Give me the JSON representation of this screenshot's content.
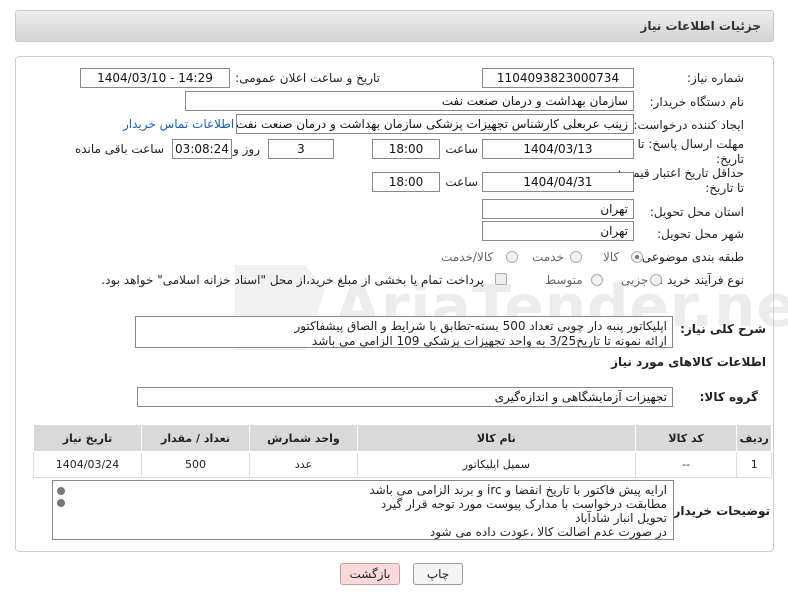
{
  "header": {
    "title": "جزئیات اطلاعات نیاز"
  },
  "fields": {
    "need_number_label": "شماره نیاز:",
    "need_number": "1104093823000734",
    "announce_label": "تاریخ و ساعت اعلان عمومی:",
    "announce_value": "1404/03/10 - 14:29",
    "buyer_org_label": "نام دستگاه خریدار:",
    "buyer_org": "سازمان بهداشت و درمان صنعت نفت",
    "creator_label": "ایجاد کننده درخواست:",
    "creator": "زینب عربعلی کارشناس تجهیزات پزشکی سازمان بهداشت و درمان صنعت نفت",
    "contact_link": "اطلاعات تماس خریدار",
    "deadline_label_1": "مهلت ارسال پاسخ: تا",
    "deadline_label_2": "تاریخ:",
    "deadline_date": "1404/03/13",
    "time_label": "ساعت",
    "deadline_time": "18:00",
    "days_value": "3",
    "days_label": "روز و",
    "remaining_value": "03:08:24",
    "remaining_label": "ساعت باقی مانده",
    "validity_label_1": "حداقل تاریخ اعتبار قیمت:",
    "validity_label_2": "تا تاریخ:",
    "validity_date": "1404/04/31",
    "validity_time": "18:00",
    "province_label": "استان محل تحویل:",
    "province": "تهران",
    "city_label": "شهر محل تحویل:",
    "city": "تهران",
    "category_label": "طبقه بندی موضوعی:",
    "category_options": [
      "کالا",
      "خدمت",
      "کالا/خدمت"
    ],
    "process_label": "نوع فرآیند خرید :",
    "process_options": [
      "جزیی",
      "متوسط"
    ],
    "payment_note": "پرداخت تمام یا بخشی از مبلغ خرید،از محل \"اسناد خزانه اسلامی\" خواهد بود."
  },
  "description": {
    "label": "شرح کلی نیاز:",
    "line1": "اپلیکاتور پنبه دار چوبی تعداد 500 بسته-تطابق با شرایط و الصاق پیشفاکتور",
    "line2": "ارائه نمونه تا تاریخ3/25 به واحد تجهیزات پزشکی 109 الزامی می باشد"
  },
  "goods": {
    "section_title": "اطلاعات کالاهای مورد نیاز",
    "group_label": "گروه کالا:",
    "group_value": "تجهیزات آزمایشگاهی و اندازه‌گیری",
    "columns": [
      "ردیف",
      "کد کالا",
      "نام کالا",
      "واحد شمارش",
      "تعداد / مقدار",
      "تاریخ نیاز"
    ],
    "rows": [
      [
        "1",
        "--",
        "سمپل اپلیکاتور",
        "عدد",
        "500",
        "1404/03/24"
      ]
    ]
  },
  "notes": {
    "label": "توضیحات خریدار:",
    "lines": [
      "ارایه  پیش فاکتور با تاریخ انقضا و irc  و برند الزامی می باشد",
      "مطابقت درخواست با مدارک پیوست مورد توجه قرار گیرد",
      "تحویل انبار شادآباد",
      "در صورت عدم اصالت کالا ،عودت داده می شود"
    ]
  },
  "buttons": {
    "print": "چاپ",
    "back": "بازگشت"
  },
  "watermark": "AriaTender.neT"
}
